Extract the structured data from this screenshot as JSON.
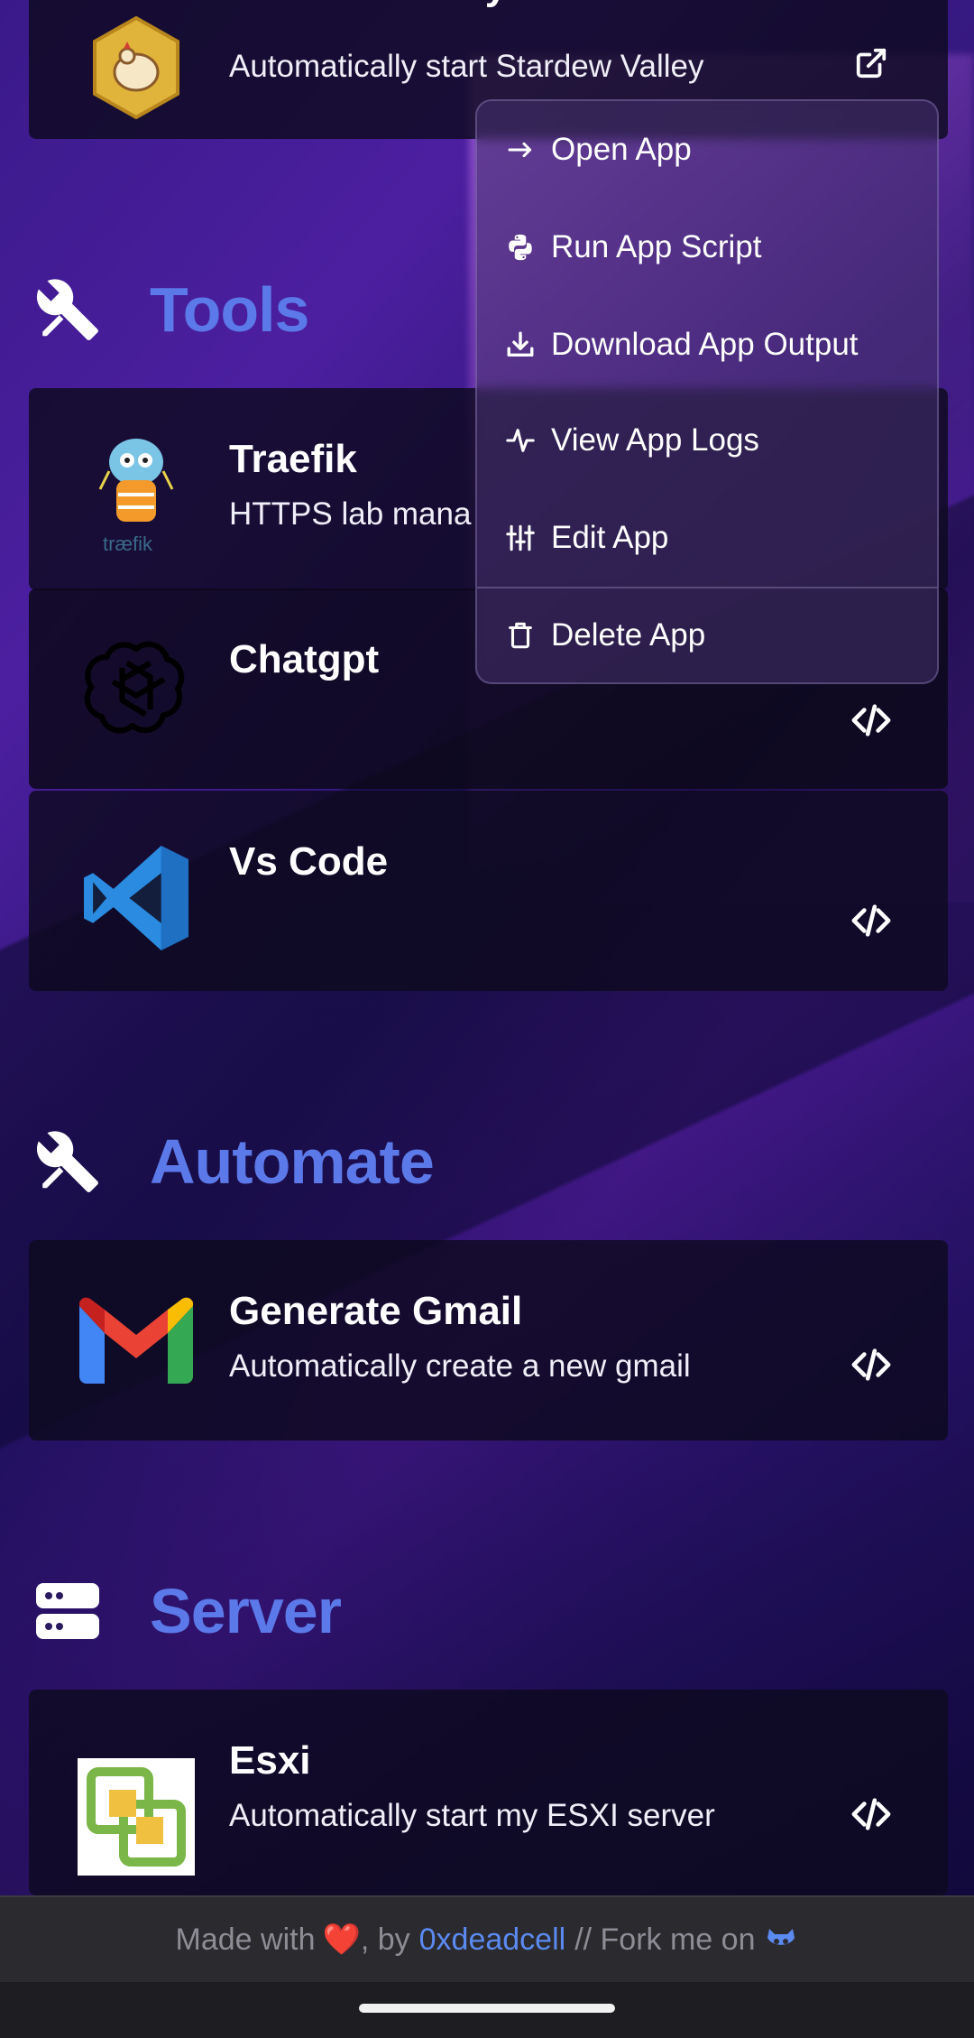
{
  "apps": {
    "stardew": {
      "name": "Stardew Valley",
      "desc": "Automatically start Stardew Valley",
      "action_icon": "external-link-icon"
    },
    "traefik": {
      "name": "Traefik",
      "desc": "HTTPS lab mana",
      "logo_text": "træfik"
    },
    "chatgpt": {
      "name": "Chatgpt"
    },
    "vscode": {
      "name": "Vs Code"
    },
    "gmail": {
      "name": "Generate Gmail",
      "desc": "Automatically create a new gmail"
    },
    "esxi": {
      "name": "Esxi",
      "desc": "Automatically start my ESXI server"
    }
  },
  "sections": {
    "tools": {
      "title": "Tools",
      "icon": "tools-icon"
    },
    "automate": {
      "title": "Automate",
      "icon": "tools-icon"
    },
    "server": {
      "title": "Server",
      "icon": "server-icon"
    }
  },
  "menu": {
    "items": [
      {
        "label": "Open App",
        "icon": "arrow-right-icon"
      },
      {
        "label": "Run App Script",
        "icon": "python-icon"
      },
      {
        "label": "Download App Output",
        "icon": "download-icon"
      },
      {
        "label": "View App Logs",
        "icon": "activity-icon"
      },
      {
        "label": "Edit App",
        "icon": "sliders-icon"
      },
      {
        "label": "Delete App",
        "icon": "trash-icon"
      }
    ]
  },
  "footer": {
    "made_with": "Made with",
    "heart": "❤️",
    "by": ", by",
    "author": "0xdeadcell",
    "fork": "// Fork me on",
    "github_icon": "github-icon"
  },
  "colors": {
    "section_title": "#5b79e8",
    "link": "#5b8af0"
  }
}
